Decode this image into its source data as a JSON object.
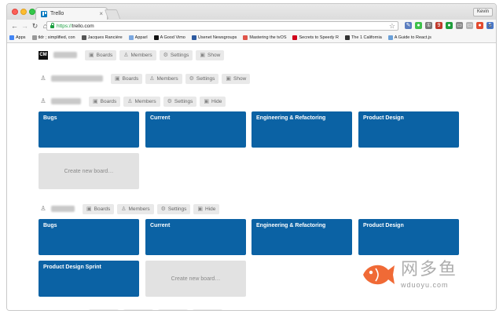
{
  "browser": {
    "tab_title": "Trello",
    "tab_close": "×",
    "profile": "Kevin",
    "url_scheme": "https://",
    "url_host": "trello.com"
  },
  "bookmarks": [
    {
      "label": "Apps",
      "color": "#4285f4"
    },
    {
      "label": "tldr ; simplified, con",
      "color": "#999999"
    },
    {
      "label": "Jacques Rancière",
      "color": "#555555"
    },
    {
      "label": "Apparl",
      "color": "#7aa7e0"
    },
    {
      "label": "A Good Vimo",
      "color": "#111111"
    },
    {
      "label": "Usenet Newsgroups",
      "color": "#2c5aa0"
    },
    {
      "label": "Mastering the tvOS",
      "color": "#e0554a"
    },
    {
      "label": "Secrets to Speedy R",
      "color": "#d0021b"
    },
    {
      "label": "The 1 California",
      "color": "#333333"
    },
    {
      "label": "A Guide to React.js",
      "color": "#6aa0d8"
    }
  ],
  "extensions": [
    {
      "glyph": "✎",
      "color": "#5a7dbf"
    },
    {
      "glyph": "●",
      "color": "#3ec14a"
    },
    {
      "glyph": "①",
      "color": "#777777"
    },
    {
      "glyph": "9",
      "color": "#c0392b"
    },
    {
      "glyph": "●",
      "color": "#1f9d3c"
    },
    {
      "glyph": "▭",
      "color": "#888888"
    },
    {
      "glyph": "▭",
      "color": "#b5b5b5"
    },
    {
      "glyph": "●",
      "color": "#e24a2e"
    },
    {
      "glyph": "5",
      "color": "#4a78c8"
    }
  ],
  "org_buttons": {
    "boards": "Boards",
    "members": "Members",
    "settings": "Settings",
    "show": "Show",
    "hide": "Hide"
  },
  "org1": {
    "logo": "CM"
  },
  "org3": {
    "boards": [
      "Bugs",
      "Current",
      "Engineering & Refactoring",
      "Product Design"
    ],
    "new_board": "Create new board…"
  },
  "org4": {
    "boards": [
      "Bugs",
      "Current",
      "Engineering & Refactoring",
      "Product Design",
      "Product Design Sprint"
    ],
    "new_board": "Create new board…"
  },
  "watermark": {
    "text": "网多鱼",
    "url": "wduoyu.com"
  },
  "colors": {
    "board_blue": "#0b62a4",
    "new_board_gray": "#e2e2e2",
    "watermark_orange": "#f06a36"
  }
}
